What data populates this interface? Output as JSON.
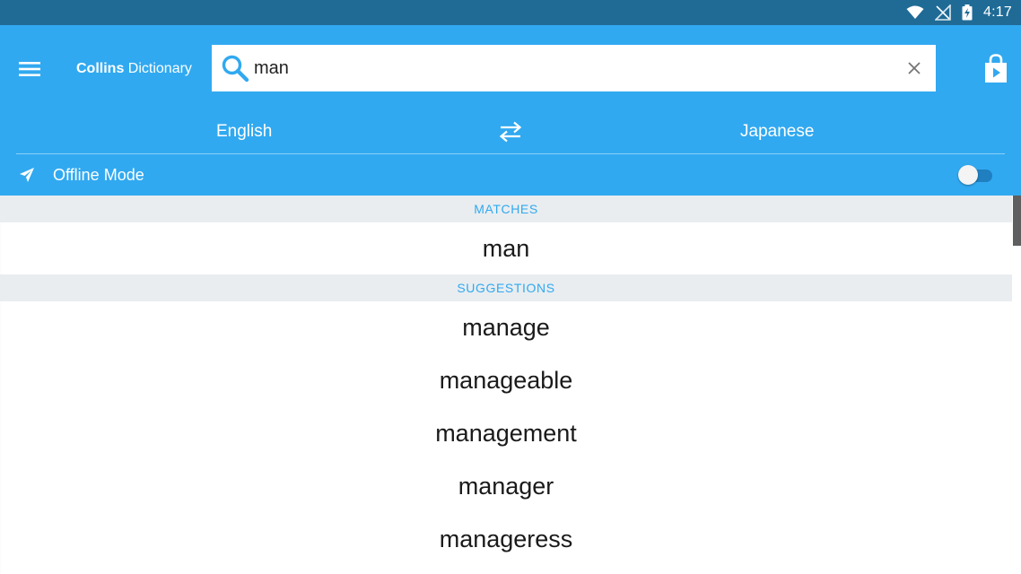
{
  "status_bar": {
    "time": "4:17",
    "icons": [
      "wifi-icon",
      "no-signal-icon",
      "battery-charging-icon"
    ]
  },
  "header": {
    "menu_icon": "hamburger-menu-icon",
    "brand": "Collins",
    "title_rest": " Dictionary",
    "store_icon": "store-bag-icon"
  },
  "search": {
    "value": "man",
    "placeholder": "",
    "search_icon": "search-icon",
    "clear_icon": "close-icon"
  },
  "languages": {
    "source": "English",
    "target": "Japanese",
    "swap_icon": "swap-arrows-icon"
  },
  "offline": {
    "label": "Offline Mode",
    "icon": "airplane-icon",
    "enabled": false
  },
  "results": {
    "matches_header": "MATCHES",
    "matches": [
      "man"
    ],
    "suggestions_header": "SUGGESTIONS",
    "suggestions": [
      "manage",
      "manageable",
      "management",
      "manager",
      "manageress"
    ]
  },
  "colors": {
    "status_bar": "#1f6b96",
    "app_bar": "#31a9f0",
    "section_header_bg": "#e9edf0",
    "section_header_text": "#31a9f0"
  }
}
